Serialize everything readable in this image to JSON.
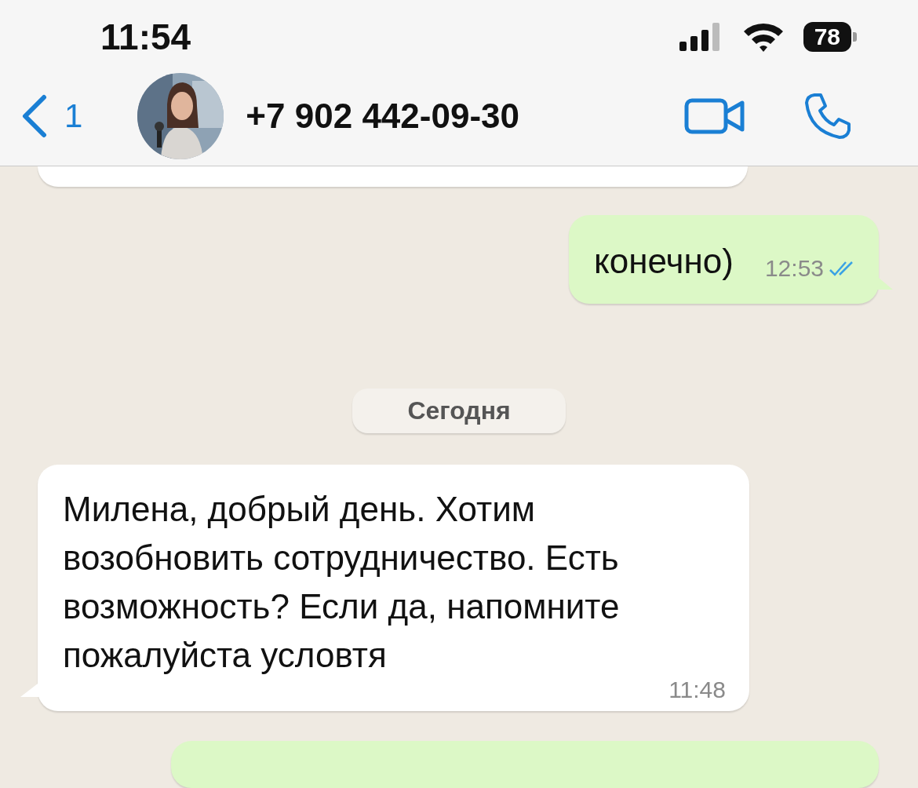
{
  "status_bar": {
    "time": "11:54",
    "battery": "78"
  },
  "header": {
    "back_count": "1",
    "title": "+7 902 442-09-30"
  },
  "messages": [
    {
      "kind": "incoming-partial"
    },
    {
      "kind": "outgoing",
      "text": "конечно)",
      "time": "12:53",
      "read": true
    },
    {
      "kind": "date",
      "text": "Сегодня"
    },
    {
      "kind": "incoming",
      "text": "Милена, добрый день. Хотим возобновить сотрудничество. Есть возможность? Если да, напомните пожалуйста условтя",
      "time": "11:48"
    },
    {
      "kind": "outgoing-partial"
    }
  ]
}
